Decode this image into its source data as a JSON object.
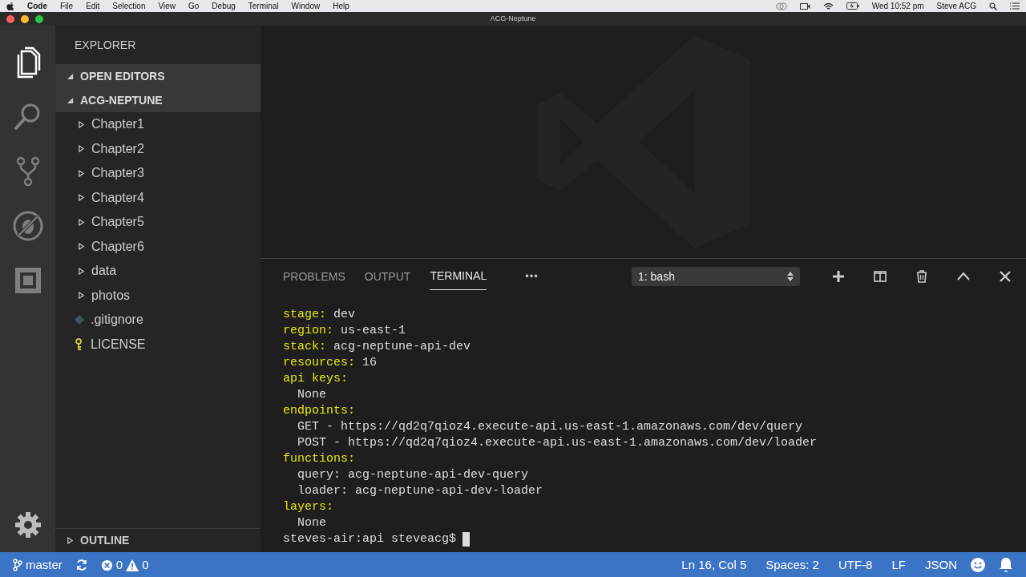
{
  "menu_bar": {
    "app": "Code",
    "items": [
      "File",
      "Edit",
      "Selection",
      "View",
      "Go",
      "Debug",
      "Terminal",
      "Window",
      "Help"
    ],
    "clock": "Wed 10:52 pm",
    "user": "Steve ACG"
  },
  "window": {
    "title": "ACG-Neptune"
  },
  "activity_bar": [
    {
      "kind": "files",
      "selected": true
    },
    {
      "kind": "search",
      "selected": false
    },
    {
      "kind": "source-control",
      "selected": false
    },
    {
      "kind": "debug",
      "selected": false
    },
    {
      "kind": "extensions",
      "selected": false
    }
  ],
  "sidebar": {
    "title": "EXPLORER",
    "sections": [
      {
        "label": "OPEN EDITORS",
        "expanded": true
      },
      {
        "label": "ACG-NEPTUNE",
        "expanded": true
      }
    ],
    "items": [
      {
        "label": "Chapter1",
        "kind": "folder"
      },
      {
        "label": "Chapter2",
        "kind": "folder"
      },
      {
        "label": "Chapter3",
        "kind": "folder"
      },
      {
        "label": "Chapter4",
        "kind": "folder"
      },
      {
        "label": "Chapter5",
        "kind": "folder"
      },
      {
        "label": "Chapter6",
        "kind": "folder"
      },
      {
        "label": "data",
        "kind": "folder"
      },
      {
        "label": "photos",
        "kind": "folder"
      },
      {
        "label": ".gitignore",
        "kind": "git"
      },
      {
        "label": "LICENSE",
        "kind": "license"
      }
    ],
    "outline": {
      "label": "OUTLINE",
      "expanded": false
    }
  },
  "panel": {
    "tabs": [
      {
        "label": "PROBLEMS",
        "selected": false
      },
      {
        "label": "OUTPUT",
        "selected": false
      },
      {
        "label": "TERMINAL",
        "selected": true
      }
    ],
    "more": "•••",
    "terminal_select": "1: bash",
    "lines": [
      {
        "kind": "key",
        "indented": false,
        "key": "stage:",
        "value": "dev"
      },
      {
        "kind": "key",
        "indented": false,
        "key": "region:",
        "value": "us-east-1"
      },
      {
        "kind": "key",
        "indented": false,
        "key": "stack:",
        "value": "acg-neptune-api-dev"
      },
      {
        "kind": "key",
        "indented": false,
        "key": "resources:",
        "value": "16"
      },
      {
        "kind": "key",
        "indented": false,
        "key": "api keys:"
      },
      {
        "kind": "plain",
        "indented": true,
        "text": "None"
      },
      {
        "kind": "key",
        "indented": false,
        "key": "endpoints:"
      },
      {
        "kind": "plain",
        "indented": true,
        "text": "GET - https://qd2q7qioz4.execute-api.us-east-1.amazonaws.com/dev/query"
      },
      {
        "kind": "plain",
        "indented": true,
        "text": "POST - https://qd2q7qioz4.execute-api.us-east-1.amazonaws.com/dev/loader"
      },
      {
        "kind": "key",
        "indented": false,
        "key": "functions:"
      },
      {
        "kind": "plain",
        "indented": true,
        "text": "query: acg-neptune-api-dev-query"
      },
      {
        "kind": "plain",
        "indented": true,
        "text": "loader: acg-neptune-api-dev-loader"
      },
      {
        "kind": "key",
        "indented": false,
        "key": "layers:"
      },
      {
        "kind": "plain",
        "indented": true,
        "text": "None"
      },
      {
        "kind": "prompt",
        "indented": false,
        "text": "steves-air:api steveacg$"
      }
    ]
  },
  "status_bar": {
    "branch": "master",
    "errors": "0",
    "warnings": "0",
    "position": "Ln 16, Col 5",
    "spaces": "Spaces: 2",
    "encoding": "UTF-8",
    "eol": "LF",
    "language": "JSON"
  }
}
